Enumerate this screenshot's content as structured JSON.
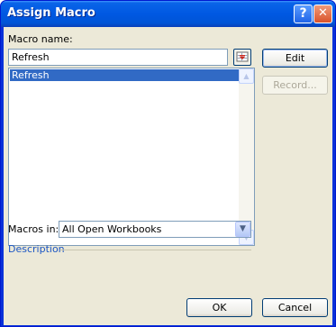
{
  "window": {
    "title": "Assign Macro",
    "help_glyph": "?",
    "close_glyph": "✕"
  },
  "macro_name": {
    "label": "Macro name:",
    "value": "Refresh"
  },
  "macro_list": {
    "items": [
      {
        "label": "Refresh",
        "selected": true
      }
    ],
    "scroll_up_glyph": "▲",
    "scroll_down_glyph": "▼"
  },
  "side_buttons": {
    "edit": "Edit",
    "record": "Record..."
  },
  "macros_in": {
    "label": "Macros in:",
    "value": "All Open Workbooks",
    "dropdown_glyph": "▼"
  },
  "description": {
    "label": "Description"
  },
  "footer": {
    "ok": "OK",
    "cancel": "Cancel"
  },
  "colors": {
    "title_bar": "#0054d6",
    "dialog_bg": "#ece9d8",
    "selection": "#316ac5",
    "link_text": "#1c56c4"
  }
}
